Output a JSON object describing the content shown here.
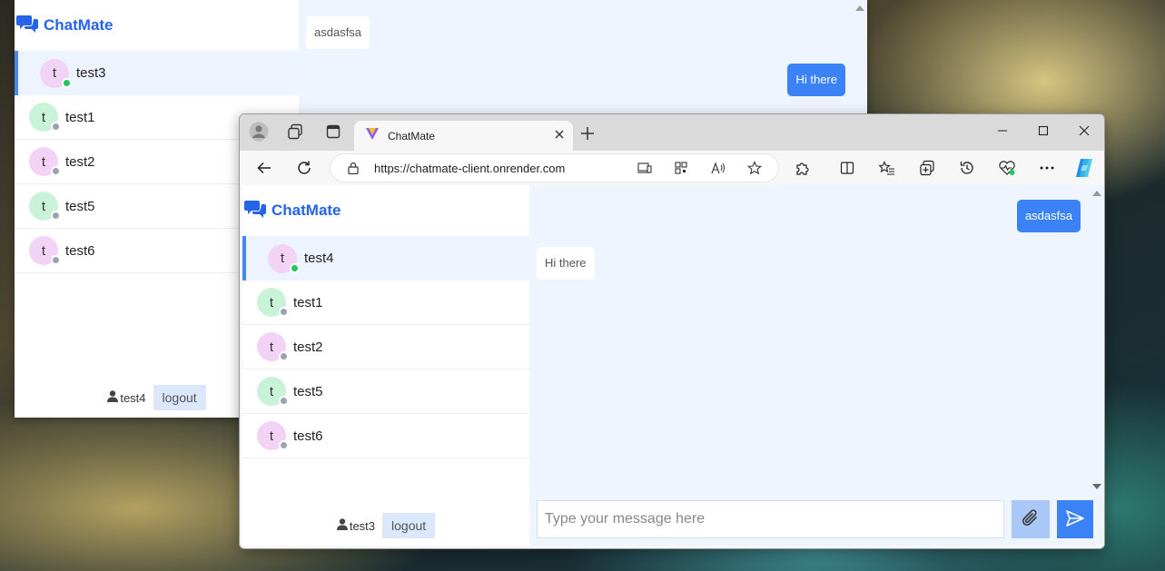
{
  "back_window": {
    "brand": "ChatMate",
    "active_contact": {
      "initial": "t",
      "name": "test3",
      "status": "online",
      "color": "pink"
    },
    "contacts": [
      {
        "initial": "t",
        "name": "test1",
        "status": "offline",
        "color": "green"
      },
      {
        "initial": "t",
        "name": "test2",
        "status": "offline",
        "color": "pink"
      },
      {
        "initial": "t",
        "name": "test5",
        "status": "offline",
        "color": "green"
      },
      {
        "initial": "t",
        "name": "test6",
        "status": "offline",
        "color": "pink"
      }
    ],
    "current_user": "test4",
    "logout_label": "logout",
    "messages": [
      {
        "text": "asdasfsa",
        "direction": "incoming"
      },
      {
        "text": "Hi there",
        "direction": "outgoing"
      }
    ]
  },
  "browser": {
    "tab_title": "ChatMate",
    "url": "https://chatmate-client.onrender.com",
    "app": {
      "brand": "ChatMate",
      "active_contact": {
        "initial": "t",
        "name": "test4",
        "status": "online",
        "color": "pink"
      },
      "contacts": [
        {
          "initial": "t",
          "name": "test1",
          "status": "offline",
          "color": "green"
        },
        {
          "initial": "t",
          "name": "test2",
          "status": "offline",
          "color": "pink"
        },
        {
          "initial": "t",
          "name": "test5",
          "status": "offline",
          "color": "green"
        },
        {
          "initial": "t",
          "name": "test6",
          "status": "offline",
          "color": "pink"
        }
      ],
      "current_user": "test3",
      "logout_label": "logout",
      "messages": [
        {
          "text": "asdasfsa",
          "direction": "outgoing"
        },
        {
          "text": "Hi there",
          "direction": "incoming"
        }
      ],
      "input_placeholder": "Type your message here"
    }
  },
  "colors": {
    "accent": "#3b82f6",
    "brand": "#2563eb",
    "online": "#22c55e",
    "offline": "#9ca3af"
  }
}
